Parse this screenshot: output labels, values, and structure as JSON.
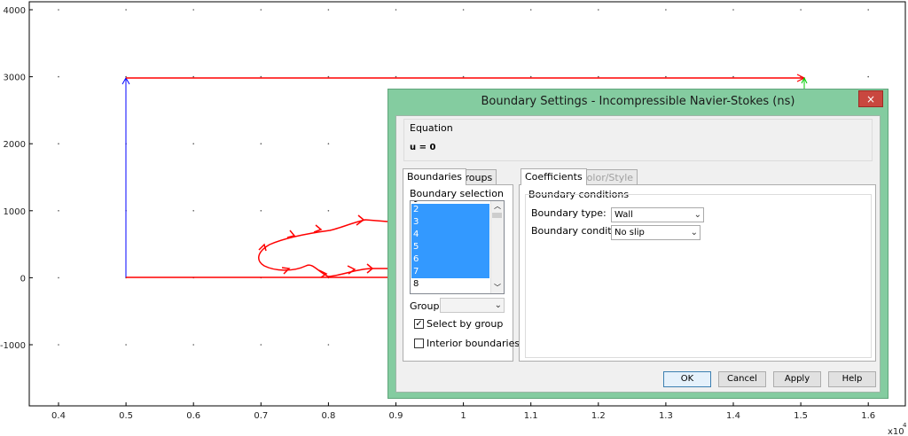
{
  "plot": {
    "y_ticks": [
      "4000",
      "3000",
      "2000",
      "1000",
      "0",
      "-1000"
    ],
    "x_ticks": [
      "0.4",
      "0.5",
      "0.6",
      "0.7",
      "0.8",
      "0.9",
      "1",
      "1.1",
      "1.2",
      "1.3",
      "1.4",
      "1.5",
      "1.6"
    ],
    "x_multiplier": "x10",
    "x_multiplier_exp": "4",
    "colors": {
      "boundary_red": "#ff0000",
      "boundary_blue": "#0000ff",
      "arrow_green": "#00cc00"
    }
  },
  "dialog": {
    "title": "Boundary Settings - Incompressible Navier-Stokes (ns)",
    "close_icon": "×",
    "equation": {
      "label": "Equation",
      "text": "u = 0"
    },
    "left_tabs": [
      {
        "label": "Boundaries",
        "active": true
      },
      {
        "label": "Groups",
        "active": false
      }
    ],
    "boundary_selection_label": "Boundary selection",
    "boundary_list": [
      "2",
      "3",
      "4",
      "5",
      "6",
      "7",
      "8"
    ],
    "selected_boundaries": [
      "2",
      "3",
      "4",
      "5",
      "6",
      "7"
    ],
    "group_label": "Group:",
    "group_value": "",
    "select_by_group": {
      "label": "Select by group",
      "checked": true
    },
    "interior_boundaries": {
      "label": "Interior boundaries",
      "checked": false
    },
    "right_tabs": [
      {
        "label": "Coefficients",
        "active": true
      },
      {
        "label": "Color/Style",
        "active": false,
        "disabled": true
      }
    ],
    "boundary_conditions_label": "Boundary conditions",
    "boundary_type": {
      "label": "Boundary type:",
      "value": "Wall"
    },
    "boundary_condition": {
      "label": "Boundary condition:",
      "value": "No slip"
    },
    "buttons": {
      "ok": "OK",
      "cancel": "Cancel",
      "apply": "Apply",
      "help": "Help"
    }
  }
}
